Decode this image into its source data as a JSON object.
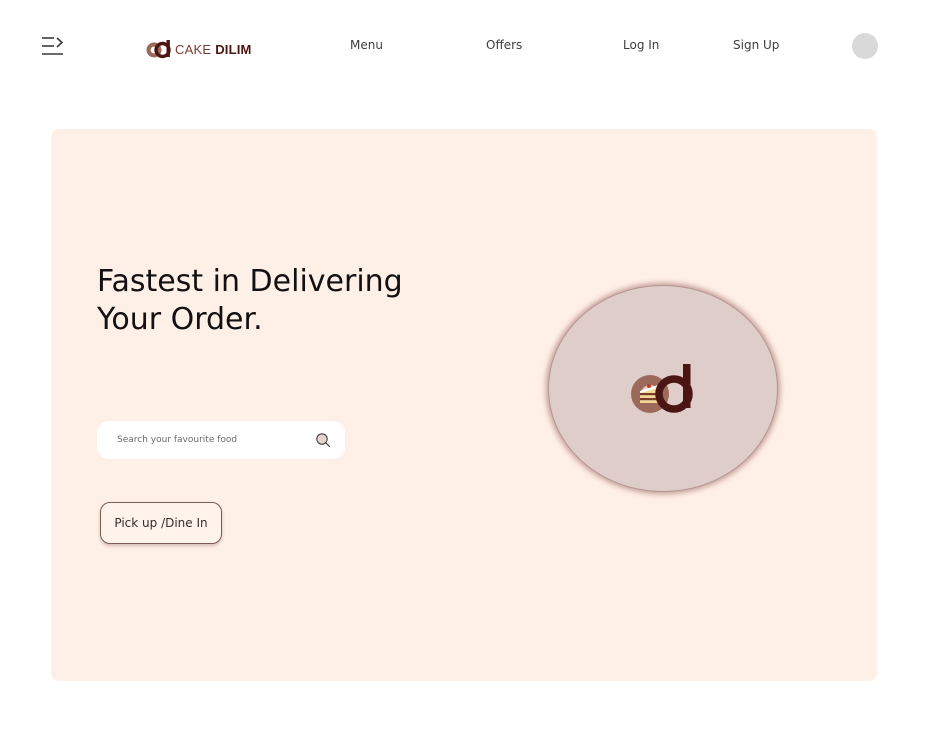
{
  "navbar": {
    "brand": {
      "word1": "CAKE",
      "word2": "DILIM"
    },
    "links": {
      "menu": "Menu",
      "offers": "Offers",
      "login": "Log In",
      "signup": "Sign Up"
    },
    "icons": {
      "menu_toggle": "menu-toggle-icon",
      "logo": "cake-dilim-logo-icon",
      "avatar": "avatar-icon"
    }
  },
  "hero": {
    "headline_line1": "Fastest in Delivering",
    "headline_line2": "Your Order.",
    "search": {
      "placeholder": "Search your favourite food",
      "value": ""
    },
    "pickup_button": "Pick up /Dine In"
  },
  "colors": {
    "hero_background": "#fff0e7",
    "brand_dark": "#4a1513",
    "brand_light": "#8c5a4c",
    "circle_fill": "#dfcdca",
    "avatar": "#d9d9d9"
  }
}
